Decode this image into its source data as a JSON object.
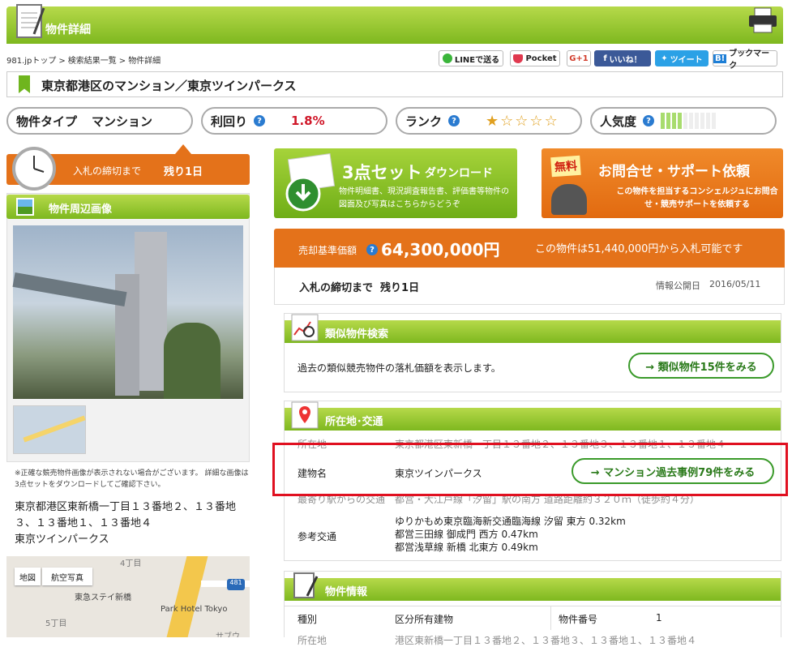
{
  "header": {
    "title": "物件詳細"
  },
  "breadcrumb": [
    "981.jpトップ",
    ">",
    "検索結果一覧",
    ">",
    "物件詳細"
  ],
  "share": {
    "line": "LINEで送る",
    "pocket": "Pocket",
    "gplus": "G+1",
    "facebook": "いいね！",
    "twitter": "ツイート",
    "hatena_b": "B!",
    "hatena": "ブックマーク"
  },
  "property_title": "東京都港区のマンション／東京ツインパークス",
  "stats": {
    "type_label": "物件タイプ",
    "type_value": "マンション",
    "yield_label": "利回り",
    "yield_value": "1.8%",
    "rank_label": "ランク",
    "rank_stars": "★☆☆☆☆",
    "popularity_label": "人気度",
    "popularity_level": 0.4
  },
  "deadline": {
    "label": "入札の締切まで",
    "value": "残り1日"
  },
  "photo_section": {
    "title": "物件周辺画像"
  },
  "photo_note": "※正確な競売物件画像が表示されない場合がございます。 詳細な画像は3点セットをダウンロードしてご確認下さい。",
  "address": "東京都港区東新橋一丁目１３番地２、１３番地３、１３番地１、１３番地４",
  "building": "東京ツインパークス",
  "map": {
    "tab_map": "地図",
    "tab_aerial": "航空写真",
    "chome": "4丁目",
    "chome2": "5丁目",
    "hotel1": "東急ステイ新橋",
    "hotel2": "Park Hotel Tokyo",
    "route": "481",
    "sub": "サブウ"
  },
  "download": {
    "title_num": "3点セット",
    "title_rest": "ダウンロード",
    "desc": "物件明細書、現況調査報告書、評価書等物件の図面及び写真はこちらからどうぞ"
  },
  "inquiry": {
    "badge": "無料",
    "title": "お問合せ・サポート依頼",
    "desc": "この物件を担当するコンシェルジュにお問合せ・競売サポートを依頼する"
  },
  "price": {
    "label": "売却基準価額",
    "value": "64,300,000円",
    "note": "この物件は51,440,000円から入札可能です"
  },
  "price_box": {
    "deadline": "入札の締切まで  残り1日",
    "published_label": "情報公開日",
    "published": "2016/05/11"
  },
  "similar": {
    "title": "類似物件検索",
    "desc": "過去の類似競売物件の落札価額を表示します。",
    "button": "→ 類似物件15件をみる"
  },
  "location": {
    "title": "所在地･交通",
    "addr_label": "所在地",
    "addr_value": "東京都港区東新橋一丁目１３番地２、１３番地３、１３番地１、１３番地４",
    "name_label": "建物名",
    "name_value": "東京ツインパークス",
    "name_button": "→ マンション過去事例79件をみる",
    "station_label": "最寄り駅からの交通",
    "station_value": "都営・大江戸線「汐留」駅の南方 道路距離約３２０ｍ（徒歩約４分）",
    "ref_label": "参考交通",
    "ref_values": [
      "ゆりかもめ東京臨海新交通臨海線 汐留 東方 0.32km",
      "都営三田線 御成門 西方 0.47km",
      "都営浅草線 新橋 北東方 0.49km"
    ]
  },
  "info": {
    "title": "物件情報",
    "kind_label": "種別",
    "kind_value": "区分所有建物",
    "num_label": "物件番号",
    "num_value": "1",
    "addr_label": "所在地",
    "addr_value": "港区東新橋一丁目１３番地２、１３番地３、１３番地１、１３番地４"
  },
  "colors": {
    "green": "#7eb81f",
    "orange": "#e4721a",
    "red_highlight": "#e01020",
    "yield_red": "#d0182a"
  }
}
